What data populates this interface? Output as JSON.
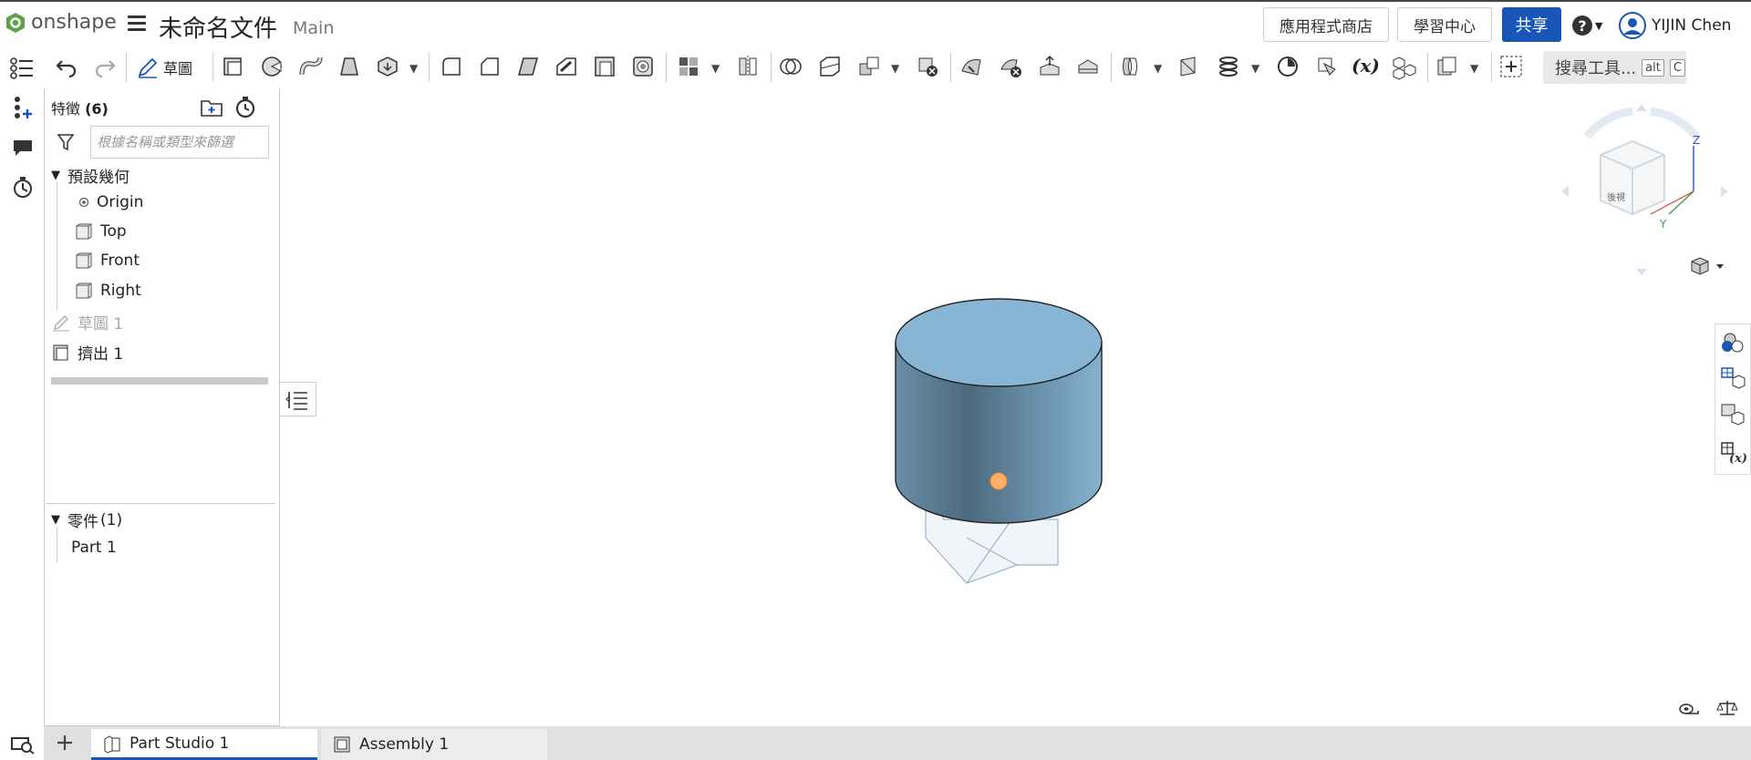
{
  "header": {
    "logo_text": "onshape",
    "title": "未命名文件",
    "branch": "Main",
    "app_store": "應用程式商店",
    "learning_center": "學習中心",
    "share": "共享",
    "user_name": "YIJIN Chen"
  },
  "toolbar": {
    "sketch_label": "草圖",
    "search_tools": "搜尋工具...",
    "search_shortcut_1": "alt",
    "search_shortcut_2": "C"
  },
  "features": {
    "header": "特徵",
    "count": "(6)",
    "filter_placeholder": "根據名稱或類型來篩選",
    "default_geometry": "預設幾何",
    "origin": "Origin",
    "top": "Top",
    "front": "Front",
    "right": "Right",
    "sketch1": "草圖 1",
    "extrude1": "擠出 1"
  },
  "parts": {
    "header": "零件",
    "count": "(1)",
    "part1": "Part 1"
  },
  "tabs": [
    {
      "label": "Part Studio 1"
    },
    {
      "label": "Assembly 1"
    }
  ],
  "viewcube": {
    "z": "Z",
    "y": "Y",
    "face_label": "後視"
  }
}
